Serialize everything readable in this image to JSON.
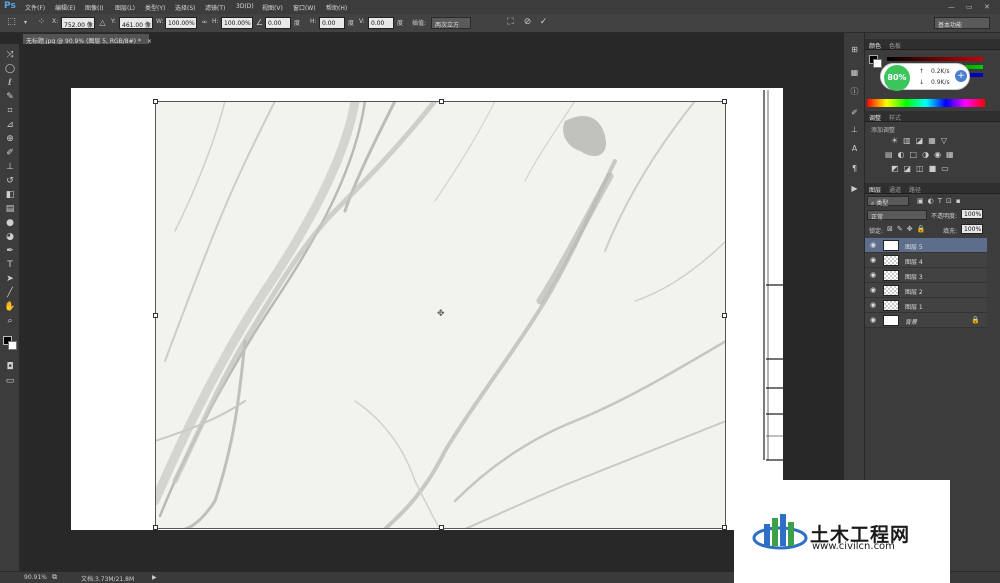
{
  "menubar": {
    "logo": "Ps",
    "items": [
      "文件(F)",
      "编辑(E)",
      "图像(I)",
      "图层(L)",
      "类型(Y)",
      "选择(S)",
      "滤镜(T)",
      "3D(D)",
      "视图(V)",
      "窗口(W)",
      "帮助(H)"
    ]
  },
  "options": {
    "x_label": "X:",
    "x_value": "752.00 像",
    "y_label": "Y:",
    "y_value": "461.00 像",
    "w_label": "W:",
    "w_value": "100.00%",
    "h_label": "H:",
    "h_value": "100.00%",
    "angle_value": "0.00",
    "angle_unit": "度",
    "hskew_label": "H:",
    "hskew_value": "0.00",
    "vskew_label": "V:",
    "vskew_value": "0.00",
    "skew_unit": "度",
    "interp_label": "插值:",
    "interp_value": "两次立方",
    "workspace": "基本功能"
  },
  "doc": {
    "tab_title": "无标题.jpg @ 90.9% (图层 5, RGB/8#) *"
  },
  "status": {
    "zoom": "90.91%",
    "doc_size": "文档:3.73M/21.8M"
  },
  "speed": {
    "percent": "80%",
    "up": "0.2K/s",
    "down": "0.9K/s"
  },
  "panels": {
    "color_tabs": [
      "颜色",
      "色板"
    ],
    "adjust_tabs": [
      "调整",
      "样式"
    ],
    "adjust_title": "添加调整",
    "layer_tabs": [
      "图层",
      "通道",
      "路径"
    ],
    "filter_kind": "类型",
    "blend_mode": "正常",
    "opacity_label": "不透明度:",
    "opacity_value": "100%",
    "lock_label": "锁定:",
    "fill_label": "填充:",
    "fill_value": "100%",
    "layers": [
      {
        "name": "图层 5",
        "selected": true
      },
      {
        "name": "图层 4",
        "selected": false
      },
      {
        "name": "图层 3",
        "selected": false
      },
      {
        "name": "图层 2",
        "selected": false
      },
      {
        "name": "图层 1",
        "selected": false
      },
      {
        "name": "背景",
        "selected": false
      }
    ]
  },
  "watermark": {
    "name": "土木工程网",
    "url": "www.civilcn.com"
  }
}
